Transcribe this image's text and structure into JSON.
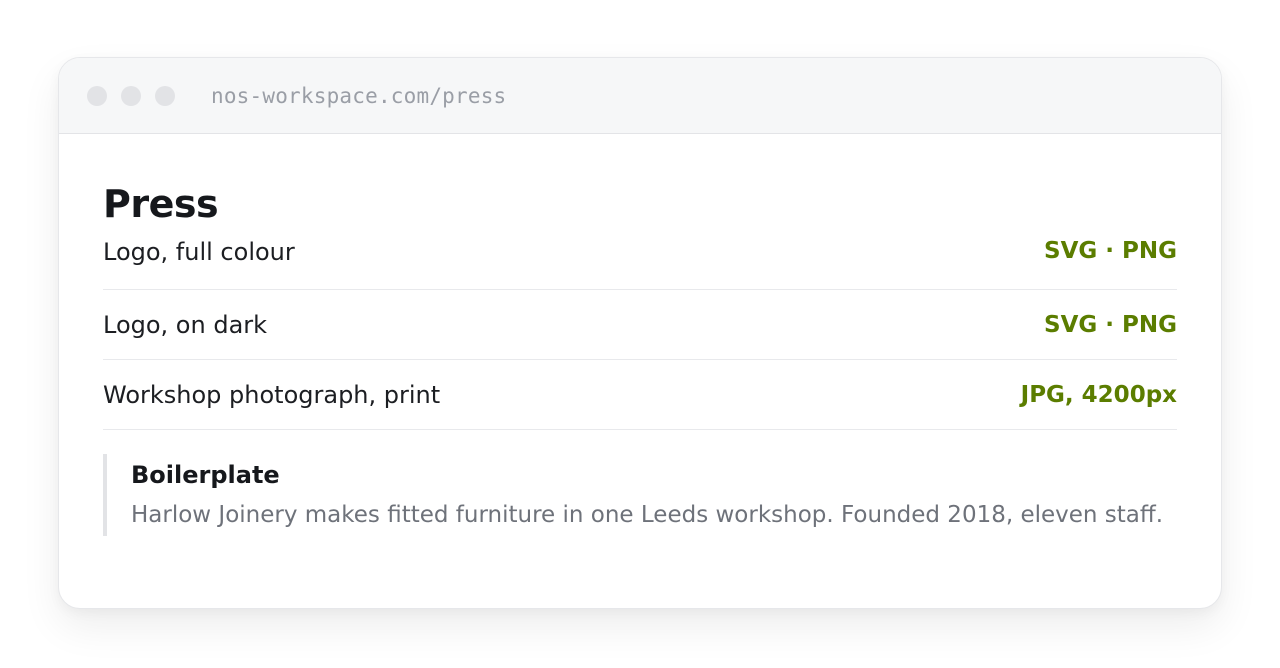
{
  "browser": {
    "url": "nos-workspace.com/press"
  },
  "page": {
    "title": "Press"
  },
  "assets": [
    {
      "name": "Logo, full colour",
      "formats": "SVG · PNG"
    },
    {
      "name": "Logo, on dark",
      "formats": "SVG · PNG"
    },
    {
      "name": "Workshop photograph, print",
      "formats": "JPG, 4200px"
    }
  ],
  "boilerplate": {
    "title": "Boilerplate",
    "text": "Harlow Joinery makes fitted furniture in one Leeds workshop. Founded 2018, eleven staff."
  },
  "colors": {
    "accent": "#5b7d00",
    "muted_text": "#6e727a"
  }
}
